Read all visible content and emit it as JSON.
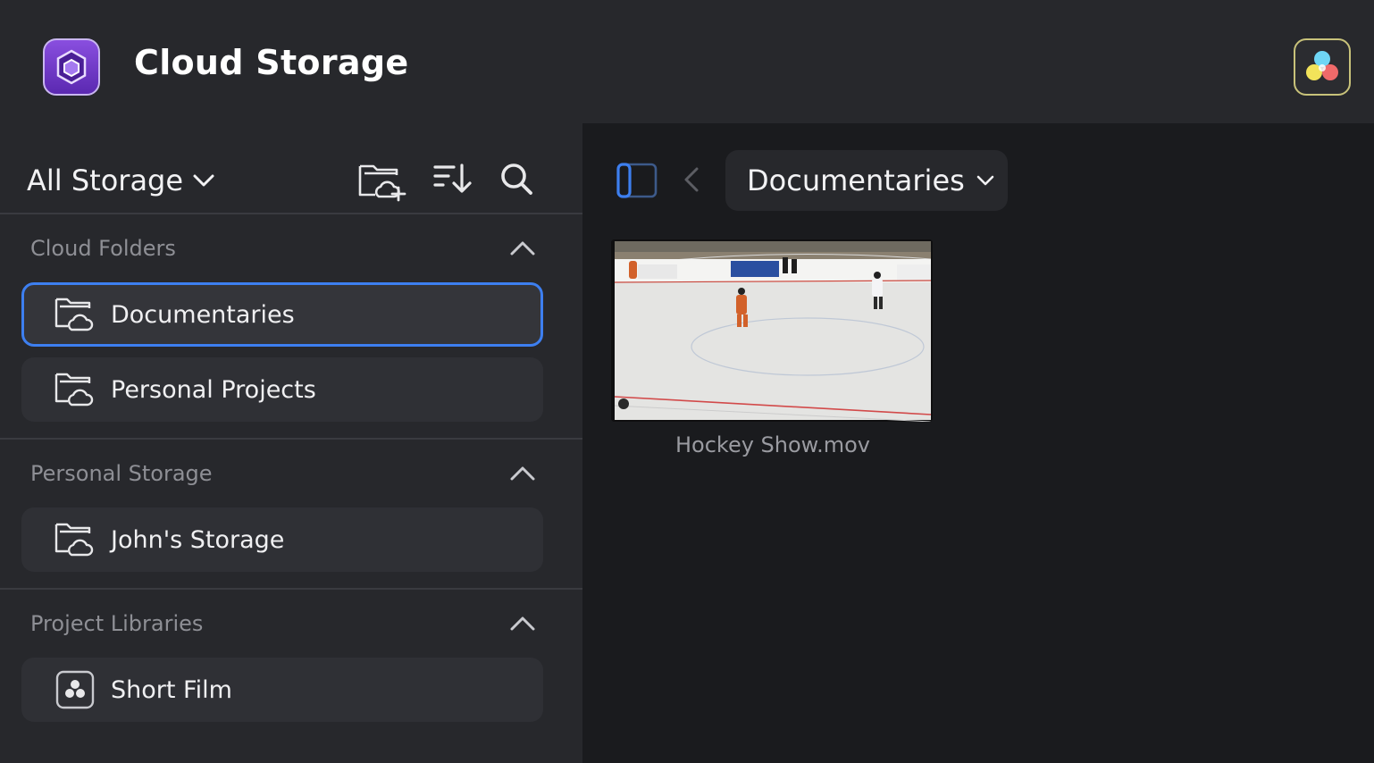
{
  "header": {
    "title": "Cloud Storage",
    "logo_icon": "cloud-storage-cube-icon",
    "right_icon": "davinci-resolve-icon",
    "accent": "#7b3fd0"
  },
  "sidebar": {
    "storage_selector": {
      "label": "All Storage",
      "icon": "chevron-down-icon"
    },
    "toolbar": [
      {
        "name": "new-cloud-folder-icon"
      },
      {
        "name": "sort-icon"
      },
      {
        "name": "search-icon"
      }
    ],
    "sections": [
      {
        "title": "Cloud Folders",
        "items": [
          {
            "label": "Documentaries",
            "icon": "cloud-folder-icon",
            "selected": true
          },
          {
            "label": "Personal Projects",
            "icon": "cloud-folder-icon",
            "selected": false
          }
        ]
      },
      {
        "title": "Personal Storage",
        "items": [
          {
            "label": "John's Storage",
            "icon": "cloud-folder-icon",
            "selected": false
          }
        ]
      },
      {
        "title": "Project Libraries",
        "items": [
          {
            "label": "Short Film",
            "icon": "resolve-library-icon",
            "selected": false
          }
        ]
      }
    ]
  },
  "main": {
    "current_folder": "Documentaries",
    "selection_color": "#3d7ff0",
    "clips": [
      {
        "name": "Hockey Show.mov"
      }
    ]
  }
}
